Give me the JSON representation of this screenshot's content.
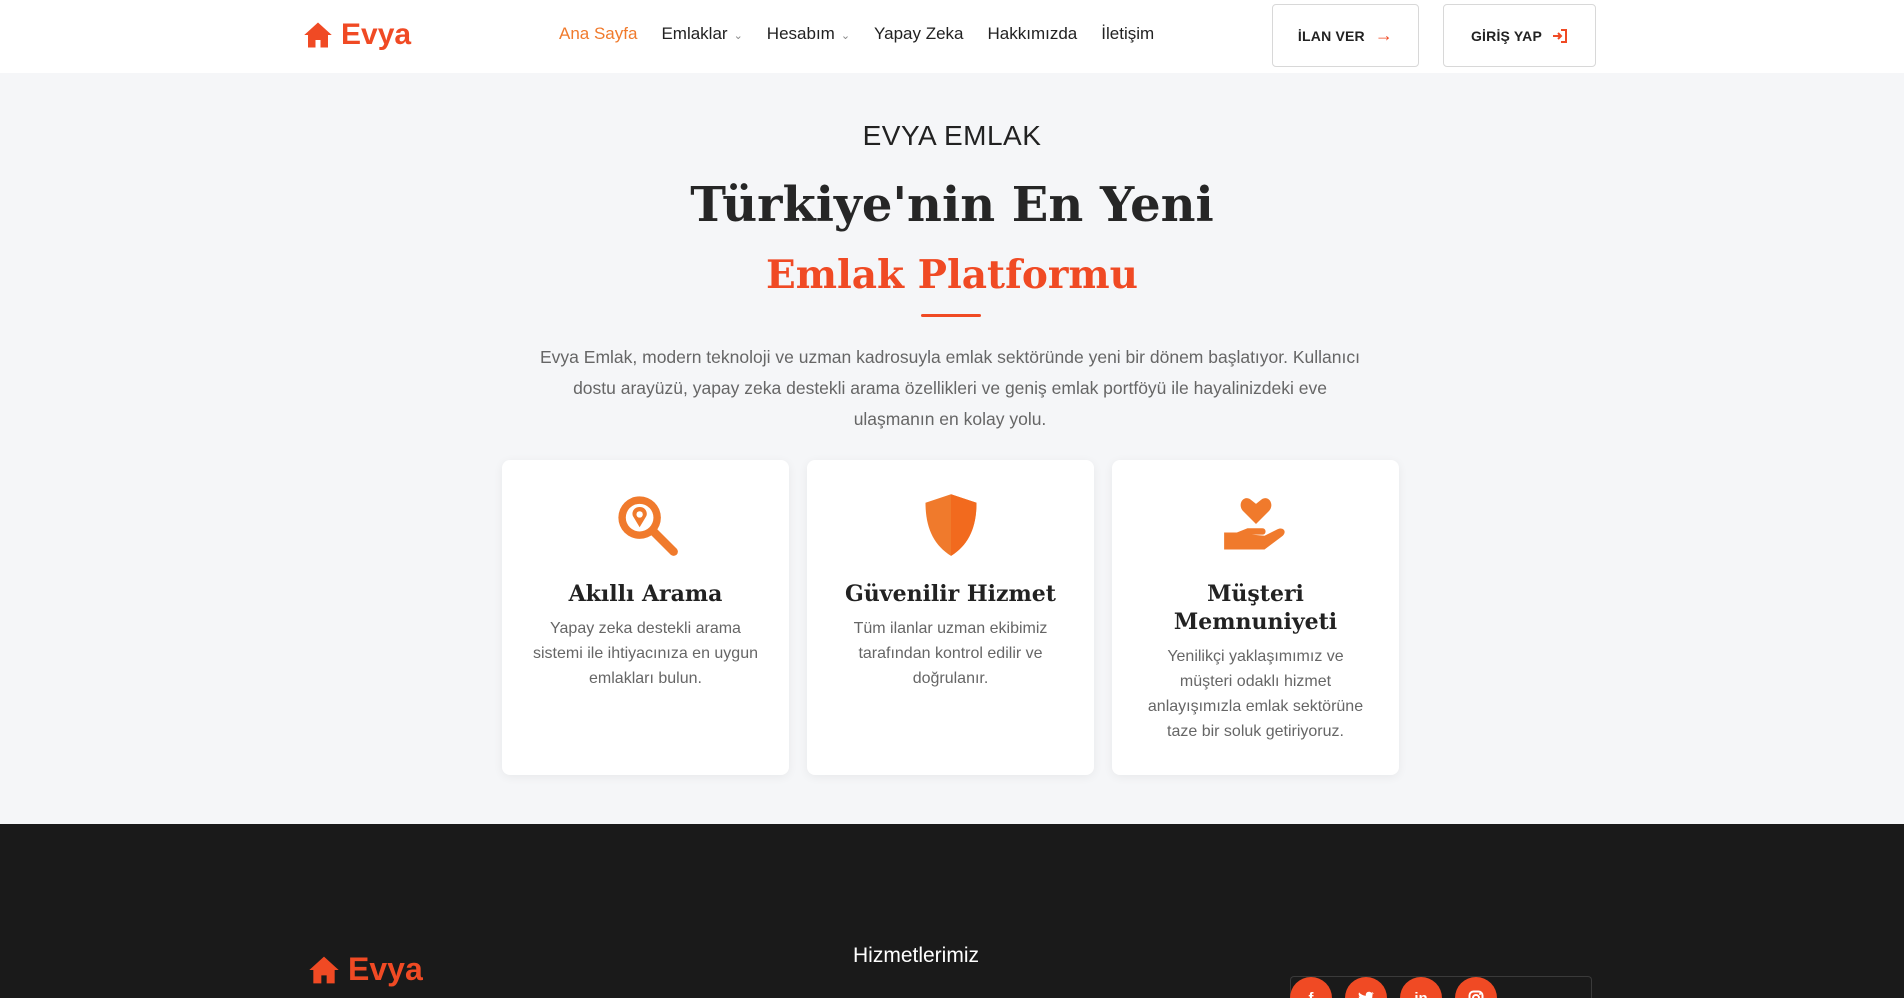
{
  "brand": {
    "name": "Evya",
    "color": "#f04a24"
  },
  "nav": {
    "items": [
      {
        "label": "Ana Sayfa",
        "active": true
      },
      {
        "label": "Emlaklar",
        "dropdown": true
      },
      {
        "label": "Hesabım",
        "dropdown": true
      },
      {
        "label": "Yapay Zeka"
      },
      {
        "label": "Hakkımızda"
      },
      {
        "label": "İletişim"
      }
    ]
  },
  "header_buttons": {
    "post_ad": "İLAN VER",
    "login": "GİRİŞ YAP"
  },
  "hero": {
    "kicker": "EVYA EMLAK",
    "title_line1": "Türkiye'nin En Yeni",
    "title_line2": "Emlak Platformu",
    "description": "Evya Emlak, modern teknoloji ve uzman kadrosuyla emlak sektöründe yeni bir dönem başlatıyor. Kullanıcı dostu arayüzü, yapay zeka destekli arama özellikleri ve geniş emlak portföyü ile hayalinizdeki eve ulaşmanın en kolay yolu."
  },
  "features": [
    {
      "icon": "search-location-icon",
      "title": "Akıllı Arama",
      "text": "Yapay zeka destekli arama sistemi ile ihtiyacınıza en uygun emlakları bulun."
    },
    {
      "icon": "shield-icon",
      "title": "Güvenilir Hizmet",
      "text": "Tüm ilanlar uzman ekibimiz tarafından kontrol edilir ve doğrulanır."
    },
    {
      "icon": "hand-heart-icon",
      "title": "Müşteri Memnuniyeti",
      "text": "Yenilikçi yaklaşımımız ve müşteri odaklı hizmet anlayışımızla emlak sektörüne taze bir soluk getiriyoruz."
    }
  ],
  "footer": {
    "brand": "Evya",
    "services_heading": "Hizmetlerimiz",
    "social": [
      "facebook-icon",
      "twitter-icon",
      "linkedin-icon",
      "instagram-icon"
    ]
  },
  "colors": {
    "accent": "#f04a24",
    "accent_orange": "#f07a2c",
    "footer_bg": "#1a1a1a"
  }
}
